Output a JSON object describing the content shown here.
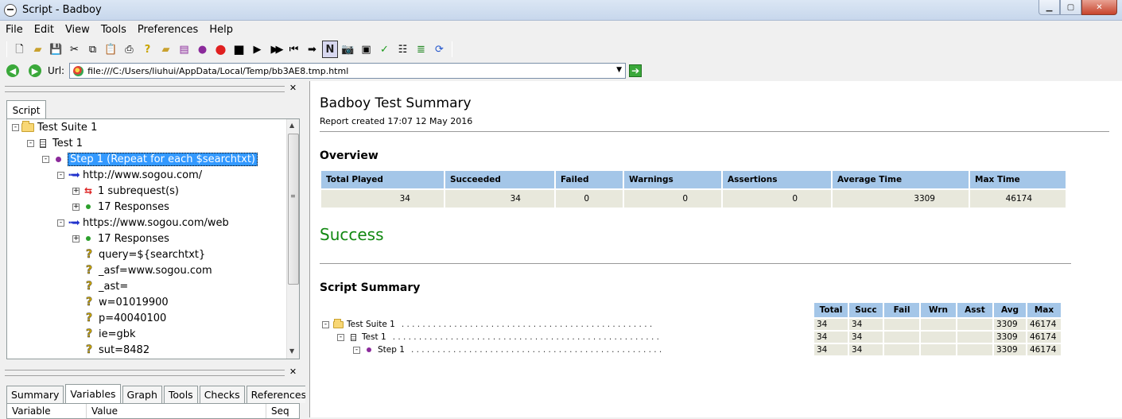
{
  "window": {
    "title": "Script - Badboy"
  },
  "menu": [
    "File",
    "Edit",
    "View",
    "Tools",
    "Preferences",
    "Help"
  ],
  "toolbar_icons": [
    "new-file",
    "open-folder",
    "save",
    "cut",
    "copy",
    "paste",
    "print",
    "help-question",
    "new-folder",
    "new-step",
    "new-test",
    "record",
    "stop",
    "play",
    "play-all",
    "rewind",
    "play-request",
    "navigation-mode",
    "screenshot",
    "capture",
    "check",
    "variables-table",
    "summary",
    "refresh"
  ],
  "urlbar": {
    "label": "Url:",
    "value": "file:///C:/Users/liuhui/AppData/Local/Temp/bb3AE8.tmp.html"
  },
  "left": {
    "script_tab": "Script",
    "tree": [
      {
        "label": "Test Suite 1",
        "icon": "folder-icon",
        "indent": 0,
        "expander": "-"
      },
      {
        "label": "Test 1",
        "icon": "test-icon",
        "indent": 1,
        "expander": "-"
      },
      {
        "label": "Step 1 (Repeat for each $searchtxt)",
        "icon": "step-icon",
        "indent": 2,
        "expander": "-",
        "selected": true
      },
      {
        "label": "http://www.sogou.com/",
        "icon": "request-icon",
        "indent": 3,
        "expander": "-"
      },
      {
        "label": "1 subrequest(s)",
        "icon": "subrequest-icon",
        "indent": 4,
        "expander": "+"
      },
      {
        "label": "17 Responses",
        "icon": "response-icon",
        "indent": 4,
        "expander": "+"
      },
      {
        "label": "https://www.sogou.com/web",
        "icon": "request-icon",
        "indent": 3,
        "expander": "-"
      },
      {
        "label": "17 Responses",
        "icon": "response-icon",
        "indent": 4,
        "expander": "+"
      },
      {
        "label": "query=${searchtxt}",
        "icon": "param-icon",
        "indent": 4,
        "expander": ""
      },
      {
        "label": "_asf=www.sogou.com",
        "icon": "param-icon",
        "indent": 4,
        "expander": ""
      },
      {
        "label": "_ast=",
        "icon": "param-icon",
        "indent": 4,
        "expander": ""
      },
      {
        "label": "w=01019900",
        "icon": "param-icon",
        "indent": 4,
        "expander": ""
      },
      {
        "label": "p=40040100",
        "icon": "param-icon",
        "indent": 4,
        "expander": ""
      },
      {
        "label": "ie=gbk",
        "icon": "param-icon",
        "indent": 4,
        "expander": ""
      },
      {
        "label": "sut=8482",
        "icon": "param-icon",
        "indent": 4,
        "expander": ""
      }
    ],
    "bottom_tabs": [
      "Summary",
      "Variables",
      "Graph",
      "Tools",
      "Checks",
      "References"
    ],
    "active_bottom_tab": "Variables",
    "var_columns": [
      "Variable",
      "Value",
      "Seq"
    ]
  },
  "report": {
    "title": "Badboy Test Summary",
    "created": "Report created 17:07 12 May 2016",
    "overview_heading": "Overview",
    "overview_headers": [
      "Total Played",
      "Succeeded",
      "Failed",
      "Warnings",
      "Assertions",
      "Average Time",
      "Max Time"
    ],
    "overview_values": [
      "34",
      "34",
      "0",
      "0",
      "0",
      "3309",
      "46174"
    ],
    "result": "Success",
    "result_color": "#118811",
    "script_summary_heading": "Script Summary",
    "ss_headers": [
      "Total",
      "Succ",
      "Fail",
      "Wrn",
      "Asst",
      "Avg",
      "Max"
    ],
    "ss_rows": [
      {
        "name": "Test Suite 1",
        "icon": "folder-icon",
        "values": [
          "34",
          "34",
          "",
          "",
          "",
          "3309",
          "46174"
        ]
      },
      {
        "name": "Test 1",
        "icon": "test-icon",
        "values": [
          "34",
          "34",
          "",
          "",
          "",
          "3309",
          "46174"
        ]
      },
      {
        "name": "Step 1",
        "icon": "step-icon",
        "values": [
          "34",
          "34",
          "",
          "",
          "",
          "3309",
          "46174"
        ]
      }
    ]
  }
}
